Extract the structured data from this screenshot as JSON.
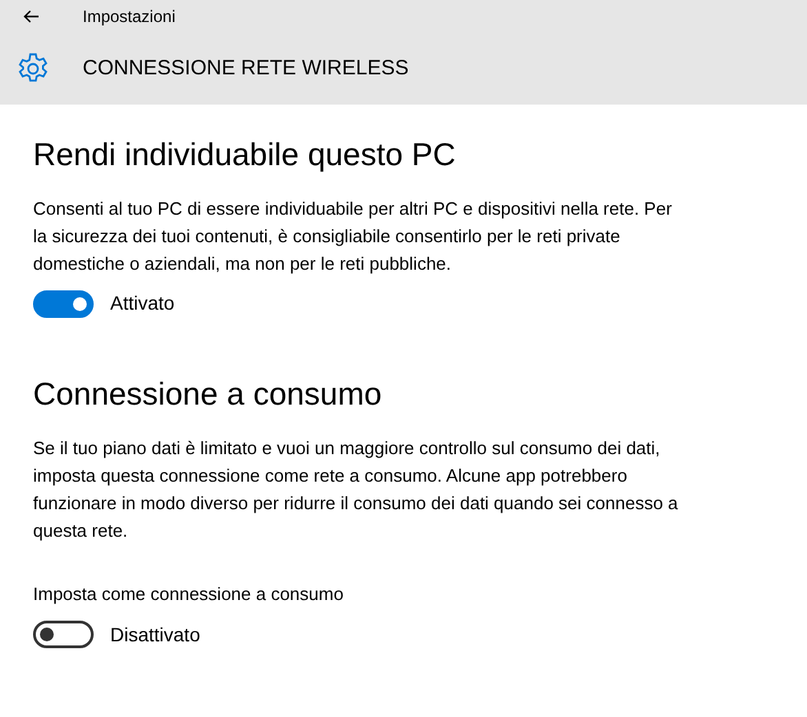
{
  "window": {
    "title": "Impostazioni"
  },
  "header": {
    "title": "CONNESSIONE RETE WIRELESS"
  },
  "sections": [
    {
      "heading": "Rendi individuabile questo PC",
      "description": "Consenti al tuo PC di essere individuabile per altri PC e dispositivi nella rete. Per la sicurezza dei tuoi contenuti, è consigliabile consentirlo per le reti private domestiche o aziendali, ma non per le reti pubbliche.",
      "toggle": {
        "on": true,
        "state_label": "Attivato"
      }
    },
    {
      "heading": "Connessione a consumo",
      "description": "Se il tuo piano dati è limitato e vuoi un maggiore controllo sul consumo dei dati, imposta questa connessione come rete a consumo. Alcune app potrebbero funzionare in modo diverso per ridurre il consumo dei dati quando sei connesso a questa rete.",
      "toggle": {
        "label": "Imposta come connessione a consumo",
        "on": false,
        "state_label": "Disattivato"
      }
    }
  ]
}
